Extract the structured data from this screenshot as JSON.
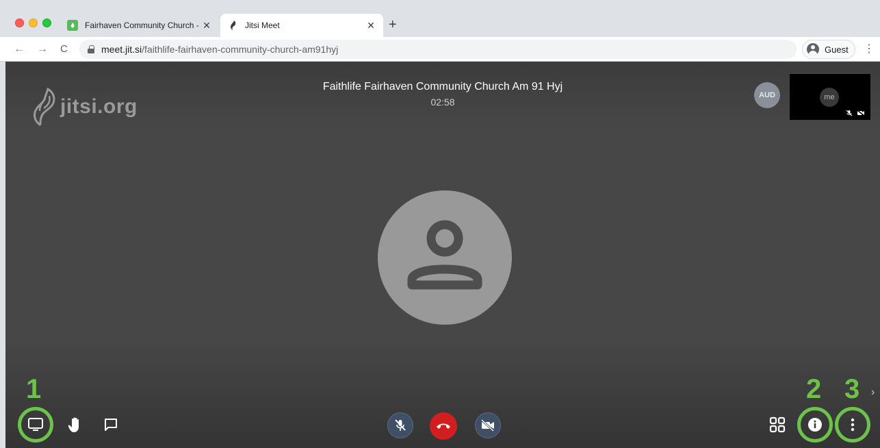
{
  "browser": {
    "tabs": [
      {
        "title": "Fairhaven Community Church - F",
        "active": false,
        "icon": "faithlife-icon"
      },
      {
        "title": "Jitsi Meet",
        "active": true,
        "icon": "jitsi-icon"
      }
    ],
    "url_host": "meet.jit.si",
    "url_path": "/faithlife-fairhaven-community-church-am91hyj",
    "profile_label": "Guest"
  },
  "meeting": {
    "logo_text": "jitsi.org",
    "title": "Faithlife Fairhaven Community Church Am 91 Hyj",
    "timer": "02:58",
    "remote_participant_initials": "AUD",
    "self_label": "me"
  },
  "annotations": {
    "step1": "1",
    "step2": "2",
    "step3": "3"
  },
  "colors": {
    "annotation_green": "#6cc24a",
    "hangup_red": "#d21e1e",
    "stage_bg": "#474747"
  }
}
